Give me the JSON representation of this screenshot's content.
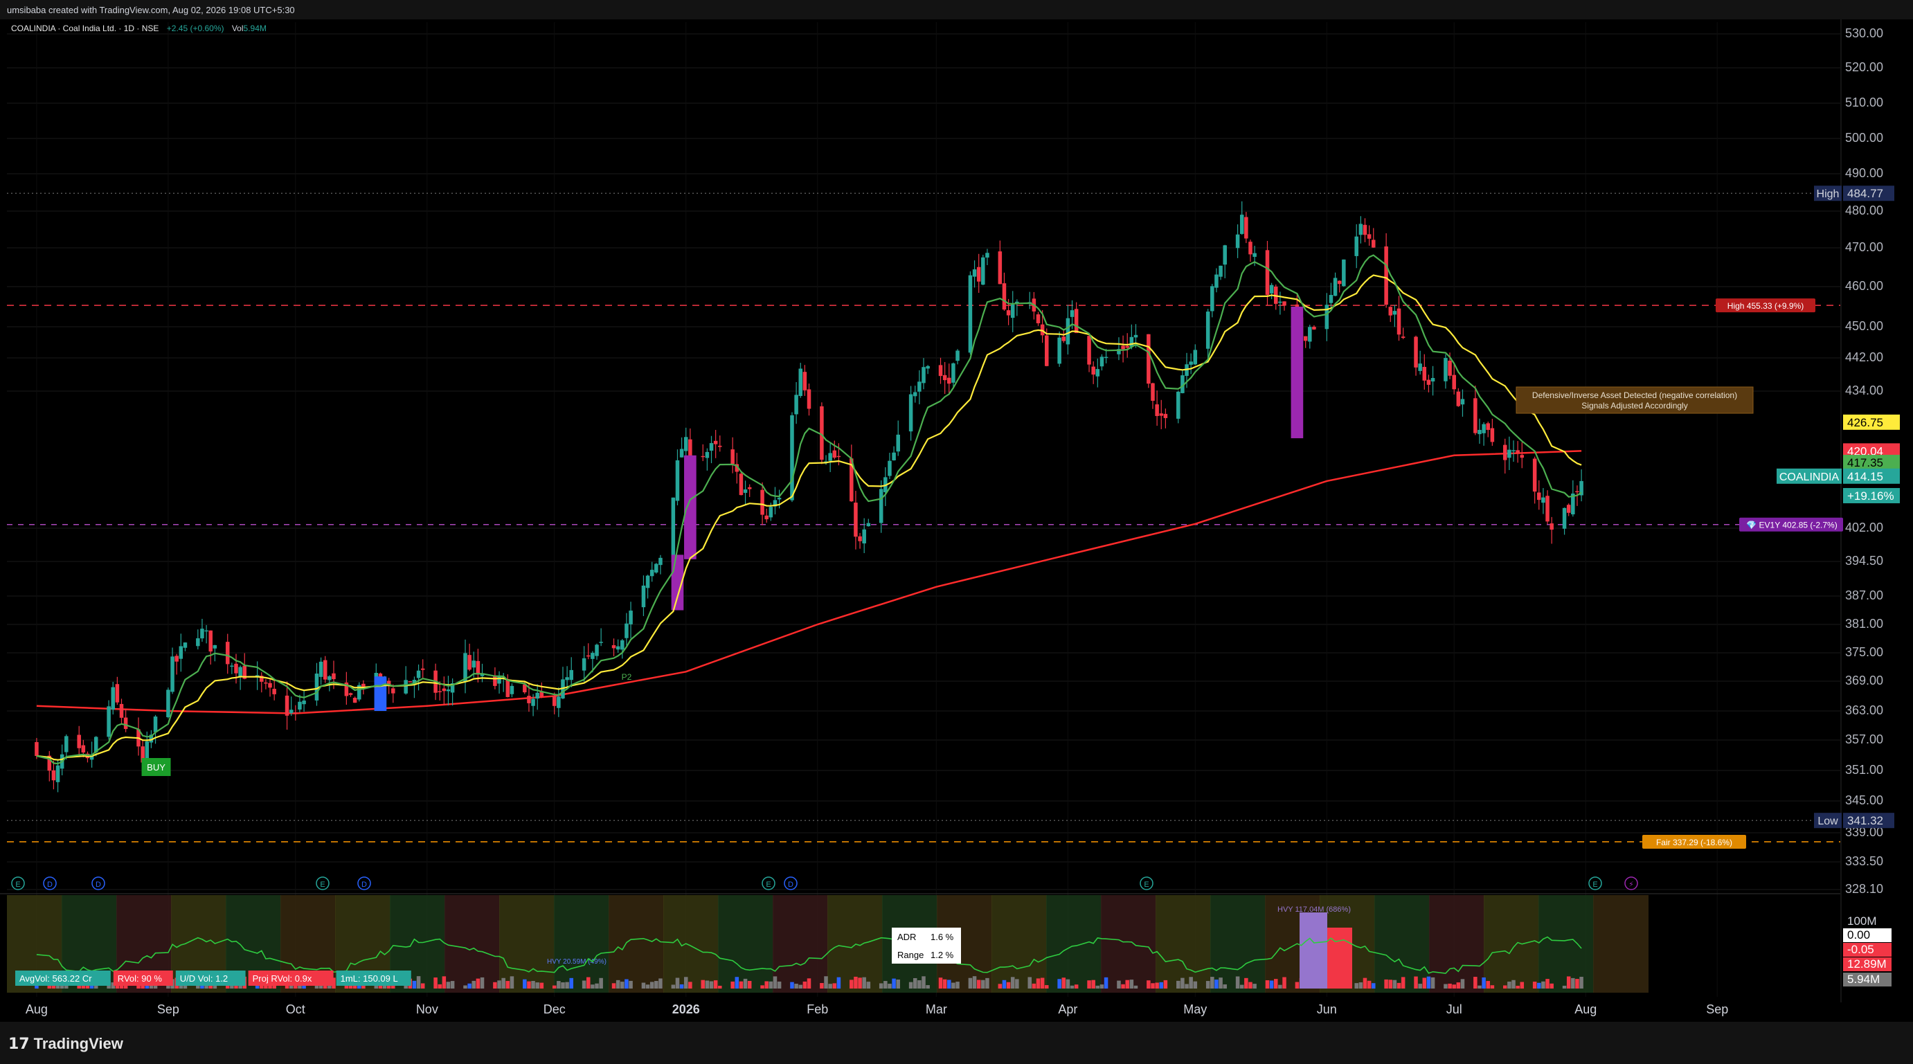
{
  "header": {
    "credit": "umsibaba created with TradingView.com, Aug 02, 2026 19:08 UTC+5:30",
    "symbol": "COALINDIA · Coal India Ltd. · 1D · NSE",
    "change": "+2.45 (+0.60%)",
    "vol_label": "Vol",
    "vol_value": "5.94M"
  },
  "brand": {
    "name": "TradingView"
  },
  "colors": {
    "up": "#26a69a",
    "down": "#f23645",
    "ema_fast": "#4caf50",
    "ema_mid": "#ffeb3b",
    "ema_slow": "#ff2b2b",
    "purple": "#9c27b0",
    "blue": "#2962ff",
    "grid": "#1a1a1a"
  },
  "chart_data": {
    "type": "candlestick",
    "symbol": "COALINDIA",
    "ylim": [
      328.1,
      532
    ],
    "y_ticks": [
      530,
      520,
      510,
      500,
      490,
      480,
      470,
      460,
      450,
      442,
      434,
      426.75,
      420.04,
      417.35,
      414.15,
      409.6,
      402,
      394.5,
      387,
      381,
      375,
      369,
      363,
      357,
      351,
      345,
      339,
      333.5,
      328.1
    ],
    "y_tick_labels": [
      "530.00",
      "520.00",
      "510.00",
      "500.00",
      "490.00",
      "480.00",
      "470.00",
      "460.00",
      "450.00",
      "442.00",
      "434.00",
      "",
      "",
      "",
      "",
      "",
      "402.00",
      "394.50",
      "387.00",
      "381.00",
      "375.00",
      "369.00",
      "363.00",
      "357.00",
      "351.00",
      "345.00",
      "339.00",
      "333.50",
      "328.10"
    ],
    "x_labels": [
      {
        "label": "Aug",
        "date": "2025-08-01"
      },
      {
        "label": "Sep",
        "date": "2025-09-01"
      },
      {
        "label": "Oct",
        "date": "2025-10-01"
      },
      {
        "label": "Nov",
        "date": "2025-11-01"
      },
      {
        "label": "Dec",
        "date": "2025-12-01"
      },
      {
        "label": "2026",
        "date": "2026-01-01"
      },
      {
        "label": "Feb",
        "date": "2026-02-01"
      },
      {
        "label": "Mar",
        "date": "2026-03-01"
      },
      {
        "label": "Apr",
        "date": "2026-04-01"
      },
      {
        "label": "May",
        "date": "2026-05-01"
      },
      {
        "label": "Jun",
        "date": "2026-06-01"
      },
      {
        "label": "Jul",
        "date": "2026-07-01"
      },
      {
        "label": "Aug",
        "date": "2026-08-01"
      },
      {
        "label": "Sep",
        "date": "2026-09-01"
      }
    ],
    "key_levels": [
      {
        "name": "High",
        "value": 484.77,
        "label": "484.77",
        "style": "dotted"
      },
      {
        "name": "High 455.33 (+9.9%)",
        "value": 455.33,
        "style": "dashed-red"
      },
      {
        "name": "EV1Y 402.85 (-2.7%)",
        "value": 402.85,
        "style": "dashed-purple"
      },
      {
        "name": "Low",
        "value": 341.32,
        "label": "341.32",
        "style": "dotted"
      },
      {
        "name": "Fair 337.29 (-18.6%)",
        "value": 337.29,
        "style": "dashed-orange"
      }
    ],
    "price_tags": [
      {
        "value": 426.75,
        "label": "426.75",
        "color": "#ffeb3b",
        "text_color": "#000"
      },
      {
        "value": 420.04,
        "label": "420.04",
        "color": "#f23645",
        "text_color": "#fff"
      },
      {
        "value": 417.35,
        "label": "417.35",
        "color": "#4caf50",
        "text_color": "#000"
      },
      {
        "value": 414.15,
        "label": "414.15",
        "color": "#26a69a",
        "text_color": "#fff"
      },
      {
        "value": 409.6,
        "label": "+19.16%",
        "color": "#26a69a",
        "text_color": "#fff"
      }
    ],
    "last_label": "COALINDIA",
    "annotation": {
      "line1": "Defensive/Inverse Asset Detected (negative correlation)",
      "line2": "Signals Adjusted Accordingly"
    },
    "signals": [
      {
        "label": "BUY",
        "date": "2025-08-29"
      },
      {
        "label": "P2",
        "date": "2025-12-18"
      }
    ],
    "ohlc_anchors": [
      [
        "2025-08-01",
        356
      ],
      [
        "2025-08-05",
        348
      ],
      [
        "2025-08-08",
        356
      ],
      [
        "2025-08-13",
        352
      ],
      [
        "2025-08-19",
        366
      ],
      [
        "2025-08-26",
        352
      ],
      [
        "2025-09-02",
        372
      ],
      [
        "2025-09-08",
        380
      ],
      [
        "2025-09-12",
        376
      ],
      [
        "2025-09-18",
        372
      ],
      [
        "2025-09-25",
        366
      ],
      [
        "2025-10-01",
        362
      ],
      [
        "2025-10-07",
        372
      ],
      [
        "2025-10-13",
        364
      ],
      [
        "2025-10-17",
        369
      ],
      [
        "2025-10-24",
        368
      ],
      [
        "2025-10-30",
        370
      ],
      [
        "2025-11-05",
        366
      ],
      [
        "2025-11-10",
        374
      ],
      [
        "2025-11-14",
        369
      ],
      [
        "2025-11-20",
        368
      ],
      [
        "2025-11-25",
        364
      ],
      [
        "2025-12-01",
        366
      ],
      [
        "2025-12-05",
        370
      ],
      [
        "2025-12-10",
        374
      ],
      [
        "2025-12-16",
        378
      ],
      [
        "2025-12-22",
        388
      ],
      [
        "2025-12-26",
        396
      ],
      [
        "2025-12-31",
        421
      ],
      [
        "2026-01-05",
        420
      ],
      [
        "2026-01-09",
        420
      ],
      [
        "2026-01-14",
        412
      ],
      [
        "2026-01-20",
        404
      ],
      [
        "2026-01-23",
        410
      ],
      [
        "2026-01-28",
        440
      ],
      [
        "2026-02-02",
        420
      ],
      [
        "2026-02-06",
        418
      ],
      [
        "2026-02-11",
        398
      ],
      [
        "2026-02-16",
        410
      ],
      [
        "2026-02-20",
        422
      ],
      [
        "2026-02-26",
        442
      ],
      [
        "2026-03-04",
        436
      ],
      [
        "2026-03-09",
        462
      ],
      [
        "2026-03-13",
        466
      ],
      [
        "2026-03-18",
        454
      ],
      [
        "2026-03-23",
        458
      ],
      [
        "2026-03-27",
        442
      ],
      [
        "2026-04-02",
        452
      ],
      [
        "2026-04-07",
        440
      ],
      [
        "2026-04-13",
        444
      ],
      [
        "2026-04-17",
        448
      ],
      [
        "2026-04-22",
        426
      ],
      [
        "2026-04-27",
        436
      ],
      [
        "2026-05-01",
        446
      ],
      [
        "2026-05-05",
        458
      ],
      [
        "2026-05-08",
        470
      ],
      [
        "2026-05-12",
        478
      ],
      [
        "2026-05-15",
        466
      ],
      [
        "2026-05-20",
        456
      ],
      [
        "2026-05-26",
        448
      ],
      [
        "2026-06-01",
        454
      ],
      [
        "2026-06-05",
        466
      ],
      [
        "2026-06-10",
        476
      ],
      [
        "2026-06-15",
        458
      ],
      [
        "2026-06-19",
        448
      ],
      [
        "2026-06-24",
        436
      ],
      [
        "2026-06-29",
        440
      ],
      [
        "2026-07-03",
        430
      ],
      [
        "2026-07-08",
        424
      ],
      [
        "2026-07-13",
        420
      ],
      [
        "2026-07-17",
        418
      ],
      [
        "2026-07-21",
        410
      ],
      [
        "2026-07-24",
        404
      ],
      [
        "2026-07-28",
        407
      ],
      [
        "2026-07-31",
        414.15
      ]
    ],
    "sma_200_anchors": [
      [
        "2025-08-01",
        364
      ],
      [
        "2025-09-01",
        363
      ],
      [
        "2025-10-01",
        362.5
      ],
      [
        "2025-11-01",
        364
      ],
      [
        "2025-12-01",
        366
      ],
      [
        "2026-01-01",
        371
      ],
      [
        "2026-02-01",
        381
      ],
      [
        "2026-03-01",
        389
      ],
      [
        "2026-04-01",
        396
      ],
      [
        "2026-05-01",
        403
      ],
      [
        "2026-06-01",
        413
      ],
      [
        "2026-07-01",
        419
      ],
      [
        "2026-07-31",
        420.04
      ]
    ],
    "purple_bars": [
      {
        "date": "2025-12-30",
        "open": 384,
        "close": 396
      },
      {
        "date": "2026-01-02",
        "open": 395,
        "close": 419
      },
      {
        "date": "2026-05-25",
        "open": 423,
        "close": 455
      }
    ],
    "blue_bars": [
      {
        "date": "2025-10-21",
        "open": 363,
        "close": 370
      }
    ],
    "event_markers": [
      "E",
      "D",
      "D",
      "E",
      "D",
      "E",
      "D",
      "E",
      "E",
      "⚡"
    ],
    "indicator": {
      "labels": [
        {
          "text": "AvgVol: 563.22 Cr",
          "bg": "#26a69a"
        },
        {
          "text": "RVol: 90 %",
          "bg": "#f23645"
        },
        {
          "text": "U/D Vol: 1.2",
          "bg": "#26a69a"
        },
        {
          "text": "Proj RVol: 0.9x",
          "bg": "#f23645"
        },
        {
          "text": "1mL: 150.09 L",
          "bg": "#26a69a"
        }
      ],
      "adr_label": "ADR",
      "adr_value": "1.6 %",
      "range_label": "Range",
      "range_value": "1.2 %",
      "hvy_text": "HVY 117.04M (686%)",
      "hvy_small": "HVY 20.59M (49%)",
      "right_ticks": [
        "100M",
        "0.00",
        "-0.05",
        "12.89M",
        "5.94M"
      ]
    }
  }
}
